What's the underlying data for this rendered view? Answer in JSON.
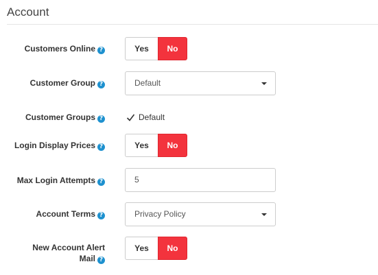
{
  "section": {
    "title": "Account"
  },
  "fields": {
    "customers_online": {
      "label": "Customers Online",
      "yes_label": "Yes",
      "no_label": "No",
      "selected": "No"
    },
    "customer_group": {
      "label": "Customer Group",
      "value": "Default"
    },
    "customer_groups": {
      "label": "Customer Groups",
      "option_label": "Default",
      "checked": true
    },
    "login_display_prices": {
      "label": "Login Display Prices",
      "yes_label": "Yes",
      "no_label": "No",
      "selected": "No"
    },
    "max_login_attempts": {
      "label": "Max Login Attempts",
      "value": "5"
    },
    "account_terms": {
      "label": "Account Terms",
      "value": "Privacy Policy"
    },
    "new_account_alert_mail": {
      "label_line1": "New Account Alert",
      "label_line2": "Mail",
      "yes_label": "Yes",
      "no_label": "No",
      "selected": "No"
    }
  },
  "help_icon_glyph": "?",
  "colors": {
    "active_no": "#f3333d",
    "help_icon": "#1e91cf",
    "border": "#cccccc"
  }
}
